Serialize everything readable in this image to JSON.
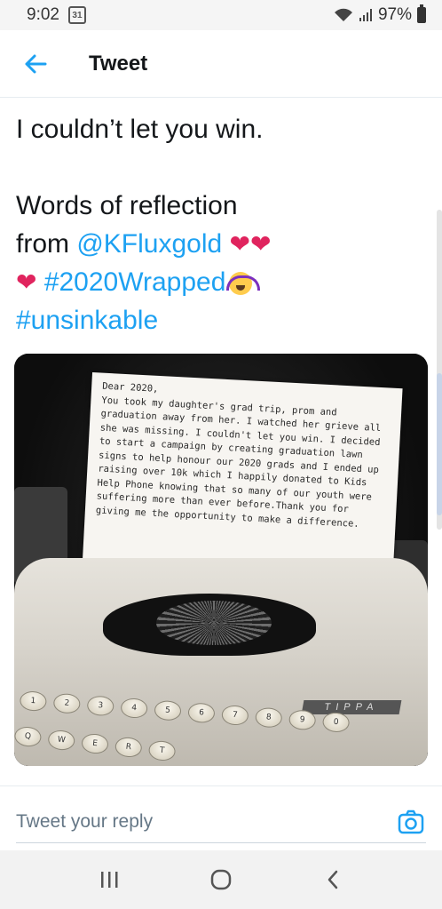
{
  "status_bar": {
    "time": "9:02",
    "calendar_day": "31",
    "battery": "97%"
  },
  "header": {
    "title": "Tweet"
  },
  "tweet": {
    "line1": "I couldn’t let you win.",
    "line2": "Words of reflection",
    "line3_prefix": "from ",
    "mention": "@KFluxgold",
    "hashtag1": "#2020Wrapped",
    "hashtag2": "#unsinkable",
    "hearts": "❤❤",
    "heart_single": "❤"
  },
  "photo": {
    "letter_text": "Dear 2020,\nYou took my daughter's grad trip, prom and graduation away from her. I watched her grieve all she was missing. I couldn't let you win. I decided to start a campaign by creating graduation lawn signs to help honour our 2020 grads and I ended up raising over 10k which I happily donated to Kids Help Phone knowing that so many of our youth were suffering more than ever before.Thank you for giving me the opportunity to make a difference.",
    "brand": "TIPPA",
    "keys_row1": [
      "1",
      "2",
      "3",
      "4",
      "5",
      "6",
      "7",
      "8",
      "9",
      "0"
    ],
    "keys_row2": [
      "Q",
      "W",
      "E",
      "R",
      "T"
    ]
  },
  "reply": {
    "placeholder": "Tweet your reply"
  },
  "colors": {
    "accent": "#1da1f2",
    "heart": "#e0245e"
  }
}
